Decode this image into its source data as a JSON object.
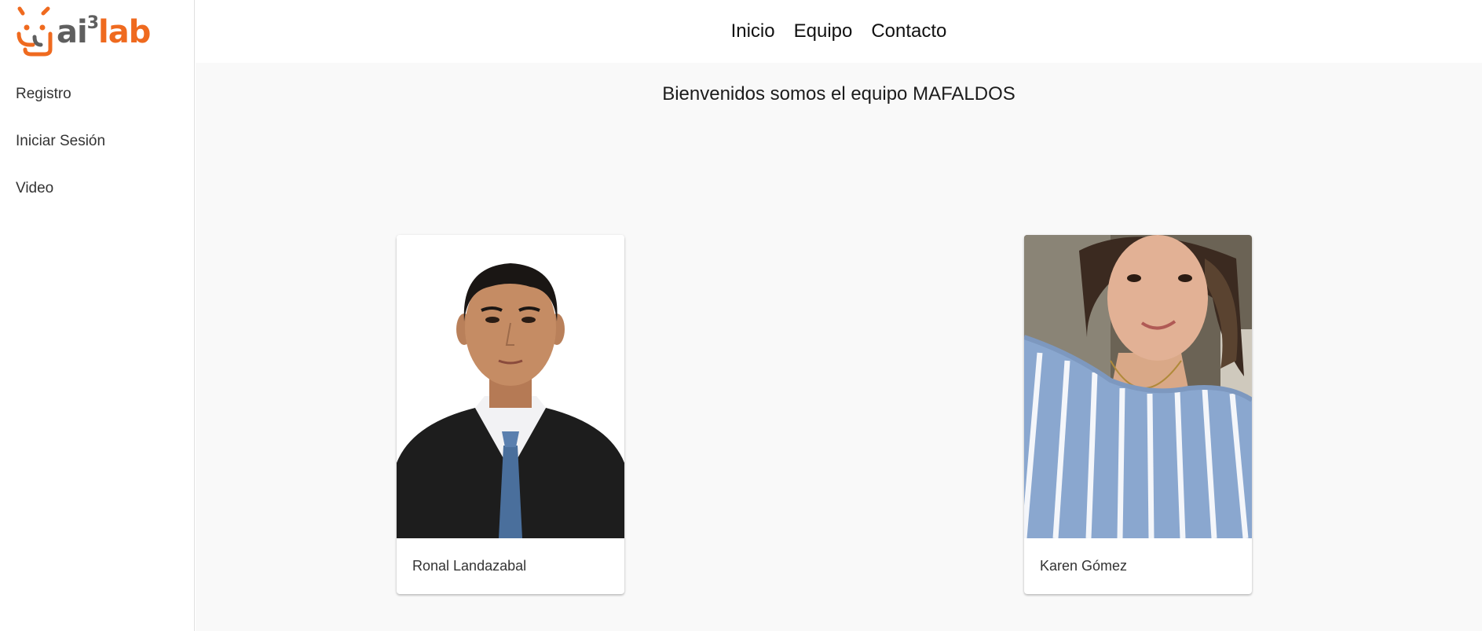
{
  "logo": {
    "text_ai": "ai",
    "text_sup": "3",
    "text_lab": "lab"
  },
  "sidebar": {
    "items": [
      {
        "label": "Registro"
      },
      {
        "label": "Iniciar Sesión"
      },
      {
        "label": "Video"
      }
    ]
  },
  "header": {
    "nav": [
      {
        "label": "Inicio"
      },
      {
        "label": "Equipo"
      },
      {
        "label": "Contacto"
      }
    ]
  },
  "main": {
    "welcome": "Bienvenidos somos el equipo MAFALDOS",
    "members": [
      {
        "name": "Ronal Landazabal"
      },
      {
        "name": "Karen Gómez"
      }
    ]
  },
  "colors": {
    "brand_orange": "#ef6a1f",
    "brand_gray": "#5f5f5f",
    "content_bg": "#f9f9f9"
  }
}
